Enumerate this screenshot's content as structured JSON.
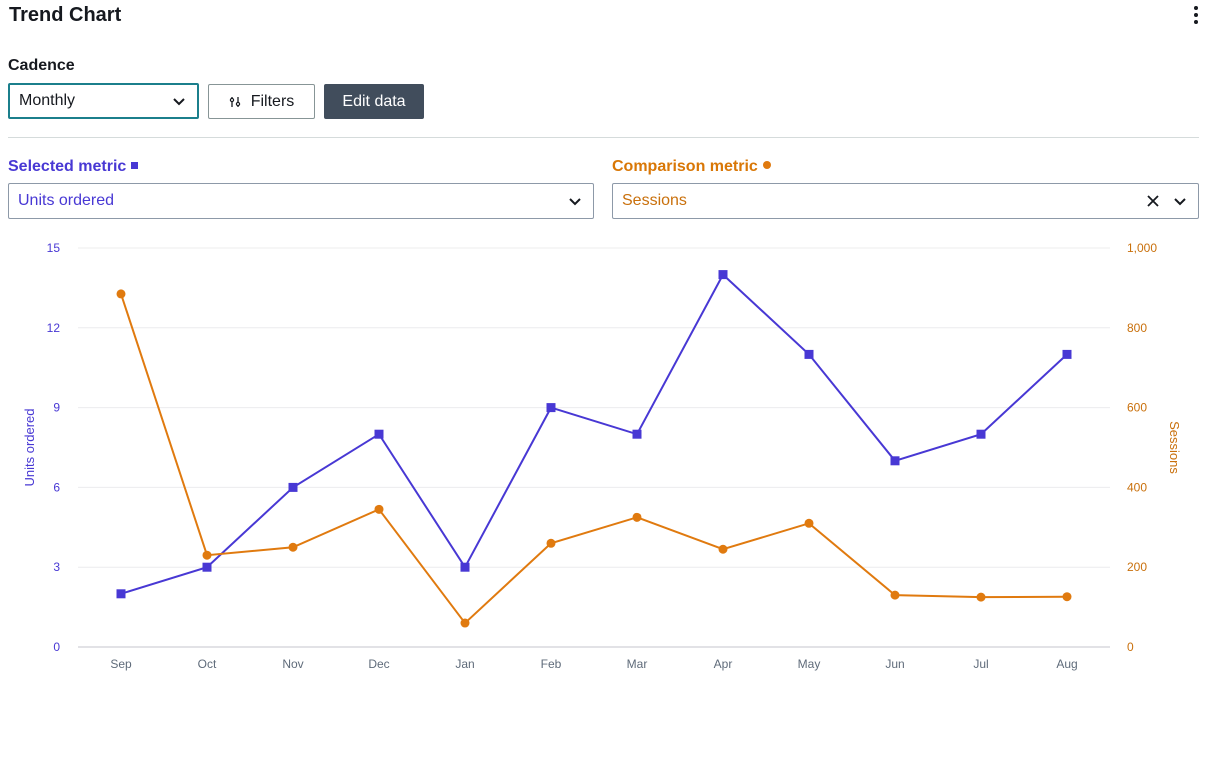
{
  "header": {
    "title": "Trend Chart",
    "menu_icon": "kebab-menu-icon"
  },
  "controls": {
    "cadence_label": "Cadence",
    "cadence_value": "Monthly",
    "filters_label": "Filters",
    "edit_label": "Edit data"
  },
  "metrics": {
    "selected_label": "Selected metric",
    "selected_value": "Units ordered",
    "comparison_label": "Comparison metric",
    "comparison_value": "Sessions"
  },
  "colors": {
    "primary": "#4838d4",
    "secondary": "#e07a0f",
    "dark_button": "#414d5c"
  },
  "chart_data": {
    "type": "line",
    "categories": [
      "Sep",
      "Oct",
      "Nov",
      "Dec",
      "Jan",
      "Feb",
      "Mar",
      "Apr",
      "May",
      "Jun",
      "Jul",
      "Aug"
    ],
    "series": [
      {
        "name": "Units ordered",
        "axis": "left",
        "color": "#4838d4",
        "marker": "square",
        "values": [
          2,
          3,
          6,
          8,
          3,
          9,
          8,
          14,
          11,
          7,
          8,
          11
        ]
      },
      {
        "name": "Sessions",
        "axis": "right",
        "color": "#e07a0f",
        "marker": "circle",
        "values": [
          885,
          230,
          250,
          345,
          60,
          260,
          325,
          245,
          310,
          130,
          125,
          126
        ]
      }
    ],
    "y_left": {
      "label": "Units ordered",
      "lim": [
        0,
        15
      ],
      "ticks": [
        "0",
        "3",
        "6",
        "9",
        "12",
        "15"
      ]
    },
    "y_right": {
      "label": "Sessions",
      "lim": [
        0,
        1000
      ],
      "ticks": [
        "0",
        "200",
        "400",
        "600",
        "800",
        "1,000"
      ]
    },
    "grid": true
  }
}
